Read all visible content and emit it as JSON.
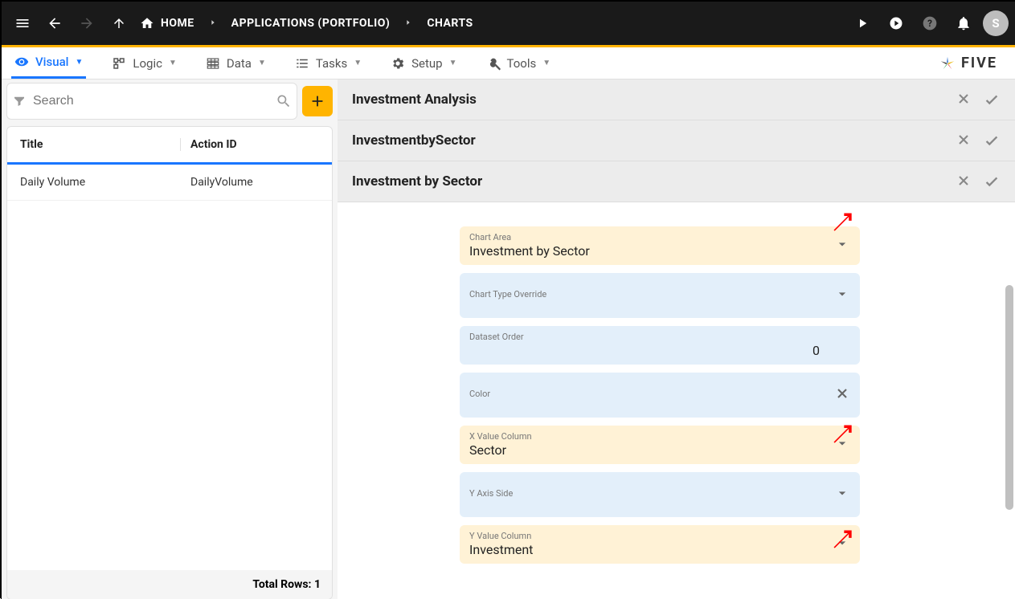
{
  "topbar": {
    "breadcrumbs": [
      "HOME",
      "APPLICATIONS (PORTFOLIO)",
      "CHARTS"
    ],
    "avatar_letter": "S"
  },
  "tabs": {
    "items": [
      {
        "label": "Visual"
      },
      {
        "label": "Logic"
      },
      {
        "label": "Data"
      },
      {
        "label": "Tasks"
      },
      {
        "label": "Setup"
      },
      {
        "label": "Tools"
      }
    ],
    "logo_text": "FIVE"
  },
  "side": {
    "search_placeholder": "Search",
    "columns": {
      "title": "Title",
      "action_id": "Action ID"
    },
    "rows": [
      {
        "title": "Daily Volume",
        "action_id": "DailyVolume"
      }
    ],
    "footer_label": "Total Rows:",
    "footer_count": "1"
  },
  "sections": [
    {
      "title": "Investment Analysis"
    },
    {
      "title": "InvestmentbySector"
    },
    {
      "title": "Investment by Sector"
    }
  ],
  "form": {
    "chart_area": {
      "label": "Chart Area",
      "value": "Investment by Sector"
    },
    "chart_type_override": {
      "label": "Chart Type Override",
      "value": ""
    },
    "dataset_order": {
      "label": "Dataset Order",
      "value": "0"
    },
    "color": {
      "label": "Color",
      "value": ""
    },
    "x_value_column": {
      "label": "X Value Column",
      "value": "Sector"
    },
    "y_axis_side": {
      "label": "Y Axis Side",
      "value": ""
    },
    "y_value_column": {
      "label": "Y Value Column",
      "value": "Investment"
    }
  }
}
